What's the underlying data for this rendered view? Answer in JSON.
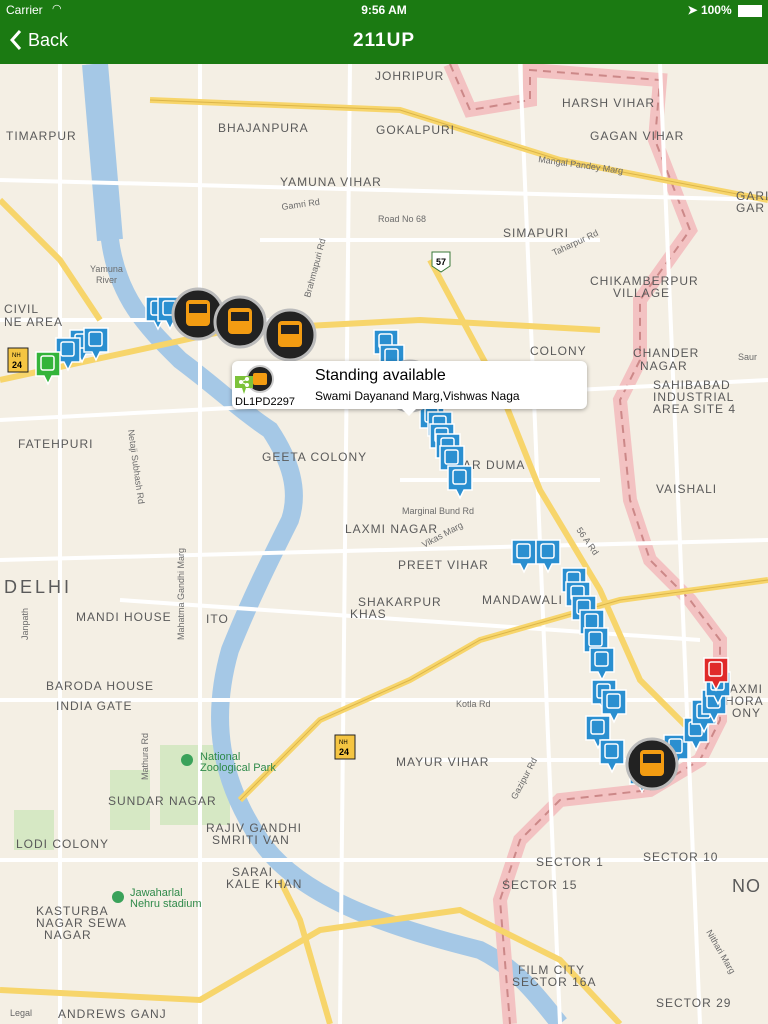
{
  "status_bar": {
    "carrier": "Carrier",
    "time": "9:56 AM",
    "battery": "100%"
  },
  "nav": {
    "back_label": "Back",
    "title": "211UP"
  },
  "callout": {
    "status": "Standing available",
    "address": "Swami Dayanand Marg,Vishwas Naga",
    "vehicle_reg": "DL1PD2297"
  },
  "map": {
    "legal": "Legal",
    "areas": [
      "JOHRIPUR",
      "HARSH VIHAR",
      "TIMARPUR",
      "BHAJANPURA",
      "GOKALPURI",
      "GAGAN VIHAR",
      "YAMUNA VIHAR",
      "SIMAPURI",
      "CIVIL",
      "NE AREA",
      "CHIKAMBERPUR",
      "VILLAGE",
      "COLONY",
      "CHANDER",
      "NAGAR",
      "SAHIBABAD",
      "INDUSTRIAL",
      "AREA SITE 4",
      "FATEHPURI",
      "GEETA COLONY",
      "VAISHALI",
      "LAXMI NAGAR",
      "PREET VIHAR",
      "DELHI",
      "MANDI HOUSE",
      "ITO",
      "SHAKARPUR",
      "KHAS",
      "MANDAWALI",
      "BARODA HOUSE",
      "INDIA GATE",
      "MAYUR VIHAR",
      "SUNDAR NAGAR",
      "RAJIV GANDHI",
      "SMRITI VAN",
      "LODI COLONY",
      "SARAI",
      "KALE KHAN",
      "KASTURBA",
      "NAGAR SEWA",
      "NAGAR",
      "SECTOR 1",
      "SECTOR 10",
      "SECTOR 15",
      "FILM CITY",
      "SECTOR 16A",
      "SECTOR 29",
      "ANDREWS GANJ",
      "NO",
      "GARI",
      "GAR",
      "AR DUMA",
      "M AXMI",
      "KHORA",
      "ONY"
    ],
    "roads": [
      "Mangal Pandey Marg",
      "Gamri Rd",
      "Road No 68",
      "Brahmapuri Rd",
      "Taharpur Rd",
      "Marginal Bund Rd",
      "Vikas Marg",
      "56 A Rd",
      "Netaji Subhash Rd",
      "Mahatma Gandhi Marg",
      "Janpath",
      "Mathura Rd",
      "Kotla Rd",
      "Gazipur Rd",
      "Nithari Marg",
      "Saur",
      "Yamuna",
      "River"
    ],
    "pois": [
      "National",
      "Zoological Park",
      "Jawaharlal",
      "Nehru stadium"
    ],
    "shields": [
      "57",
      "NH",
      "24",
      "NH",
      "24"
    ]
  }
}
